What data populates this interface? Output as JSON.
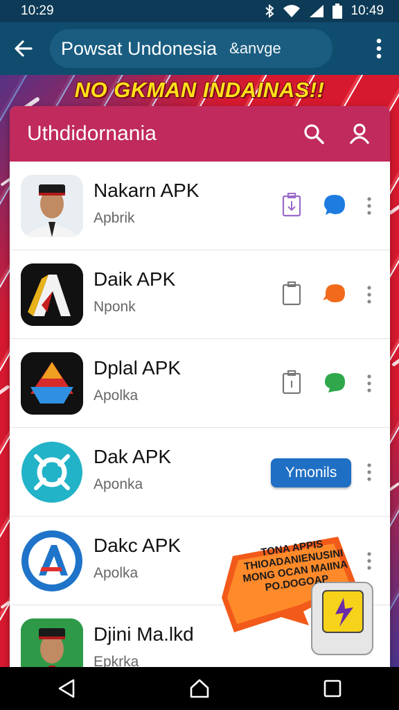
{
  "status_bar": {
    "time_left": "10:29",
    "time_right": "10:49"
  },
  "app_bar": {
    "search_text": "Powsat Undonesia",
    "search_sub": "&anvge"
  },
  "banner": {
    "text": "NO GKMAN INDAINAS!!"
  },
  "card": {
    "title": "Uthdidornania",
    "apps": [
      {
        "name": "Nakarn APK",
        "sub": "Apbrik",
        "action": "icons"
      },
      {
        "name": "Daik APK",
        "sub": "Nponk",
        "action": "icons"
      },
      {
        "name": "Dplal APK",
        "sub": "Apolka",
        "action": "icons"
      },
      {
        "name": "Dak APK",
        "sub": "Aponka",
        "action": "button",
        "button_label": "Ymonils"
      },
      {
        "name": "Dakc APK",
        "sub": "Apolka",
        "action": "more"
      },
      {
        "name": "Djini Ma.lkd",
        "sub": "Epkrka",
        "action": "more"
      }
    ]
  },
  "promo": {
    "lines": [
      "TONA APPIS",
      "THIOADANIENUSINI",
      "MONG OCAN MAIINA",
      "PO.DOGOAP"
    ]
  },
  "colors": {
    "status_bar": "#0d3a56",
    "app_bar": "#0f4c6e",
    "card_header": "#c02a5c",
    "install_button": "#1f6fc4",
    "banner_text": "#ffe11a"
  },
  "icons": {
    "back": "arrow-left-icon",
    "overflow": "more-vert-icon",
    "search": "search-icon",
    "account": "person-icon",
    "share": "share-icon"
  }
}
